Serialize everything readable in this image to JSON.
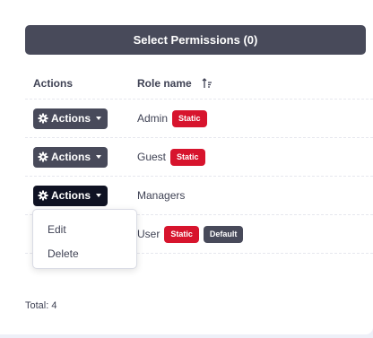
{
  "select_permissions": {
    "label": "Select Permissions (0)"
  },
  "table": {
    "headers": {
      "actions": "Actions",
      "role_name": "Role name"
    },
    "rows": [
      {
        "action_label": "Actions",
        "role": "Admin",
        "badges": [
          "Static"
        ]
      },
      {
        "action_label": "Actions",
        "role": "Guest",
        "badges": [
          "Static"
        ]
      },
      {
        "action_label": "Actions",
        "role": "Managers",
        "badges": []
      },
      {
        "action_label": "Actions",
        "role": "User",
        "badges": [
          "Static",
          "Default"
        ]
      }
    ]
  },
  "dropdown": {
    "items": [
      "Edit",
      "Delete"
    ]
  },
  "footer": {
    "total": "Total: 4"
  },
  "colors": {
    "dark_button": "#484a5a",
    "static_badge": "#d7142d",
    "default_badge": "#484a5a"
  },
  "icons": {
    "actions": "gear-icon",
    "sort": "sort-ascending-icon",
    "caret": "caret-down-icon"
  }
}
